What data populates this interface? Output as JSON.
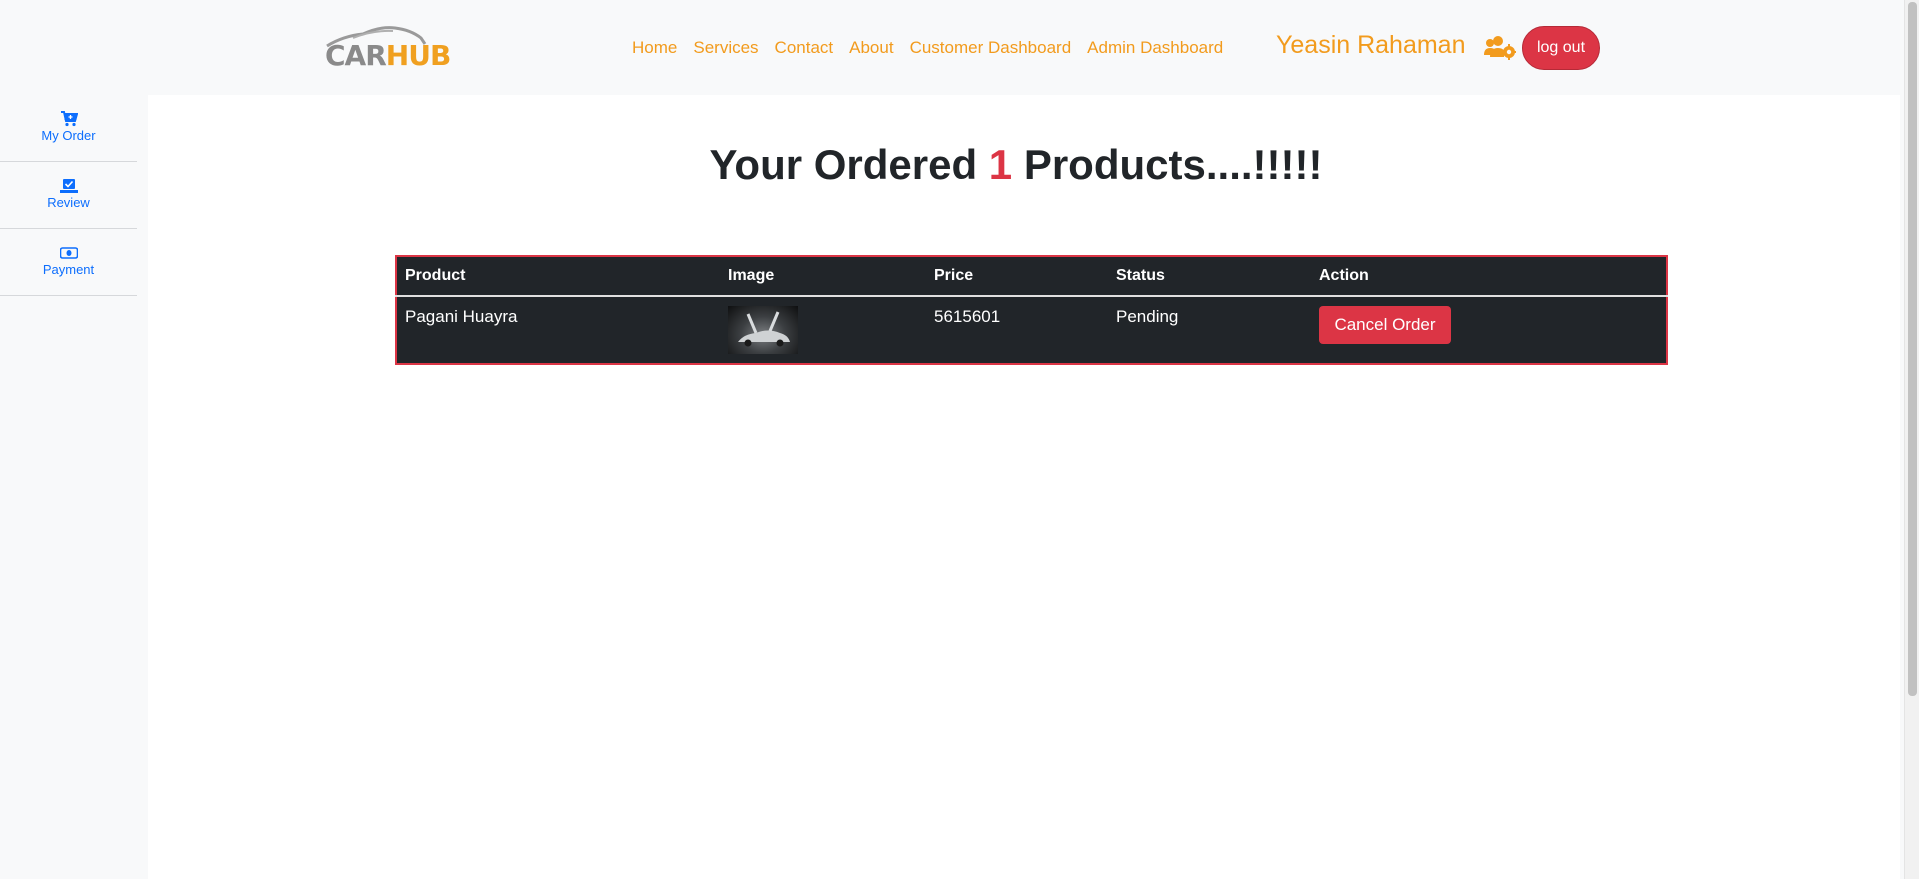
{
  "brand": {
    "logo_left": "CAR",
    "logo_right": "HUB"
  },
  "nav": {
    "links": [
      "Home",
      "Services",
      "Contact",
      "About",
      "Customer Dashboard",
      "Admin Dashboard"
    ],
    "user_name": "Yeasin Rahaman",
    "user_icon": "users-cog-icon",
    "logout_label": "log out"
  },
  "sidebar": {
    "items": [
      {
        "label": "My Order",
        "icon": "cart-plus-icon"
      },
      {
        "label": "Review",
        "icon": "check-box-icon"
      },
      {
        "label": "Payment",
        "icon": "money-bill-icon"
      }
    ]
  },
  "main": {
    "title_prefix": "Your Ordered ",
    "order_count": "1",
    "title_suffix": " Products....!!!!!",
    "table": {
      "headers": [
        "Product",
        "Image",
        "Price",
        "Status",
        "Action"
      ],
      "rows": [
        {
          "product": "Pagani Huayra",
          "image": "car-thumbnail",
          "price": "5615601",
          "status": "Pending",
          "action_label": "Cancel Order"
        }
      ]
    }
  },
  "colors": {
    "accent": "#f29b1d",
    "danger": "#dc3545",
    "link": "#0d6efd",
    "table_bg": "#212529"
  }
}
